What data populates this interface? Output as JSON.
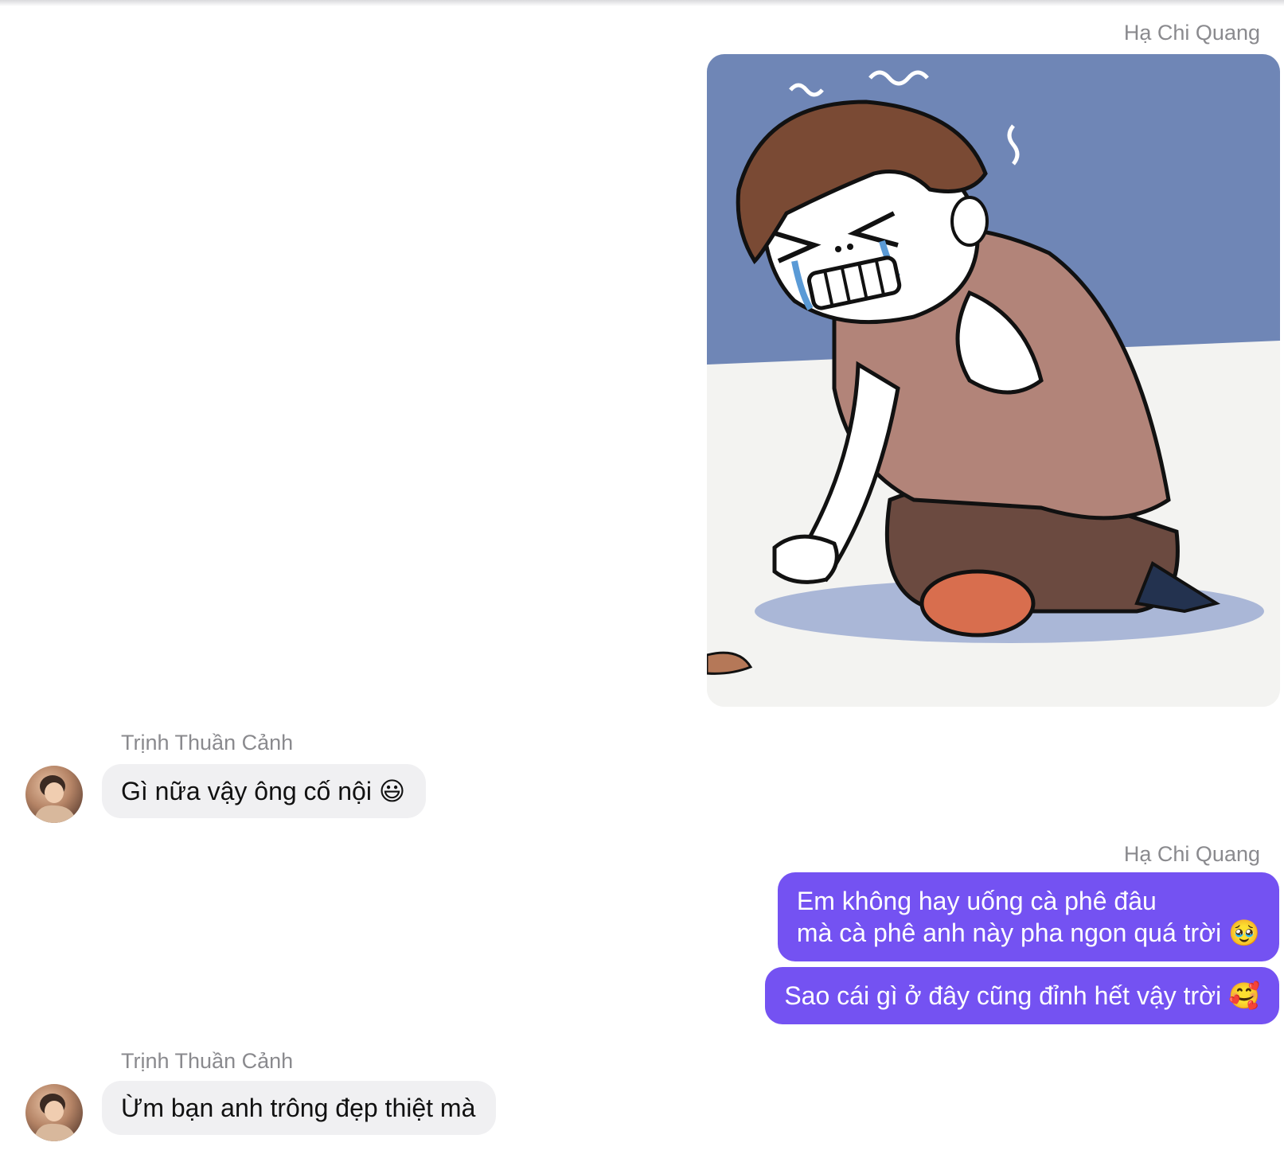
{
  "conversation": {
    "messages": [
      {
        "sender": "Hạ Chi Quang",
        "attachment": "crying-cartoon-image"
      },
      {
        "sender": "Trịnh Thuần Cảnh",
        "text": "Gì nữa vậy ông cố nội 😃"
      },
      {
        "sender": "Hạ Chi Quang",
        "lines": [
          "Em không hay uống cà phê đâu",
          "mà cà phê anh này pha ngon quá trời 🥹"
        ],
        "text2": "Sao cái gì ở đây cũng đỉnh hết vậy trời 🥰"
      },
      {
        "sender": "Trịnh Thuần Cảnh",
        "text": "Ừm bạn anh trông đẹp thiệt mà"
      }
    ]
  },
  "colors": {
    "outgoing_bubble": "#7452f2",
    "incoming_bubble": "#f0f0f2",
    "sender_name": "#8a8a8e"
  }
}
